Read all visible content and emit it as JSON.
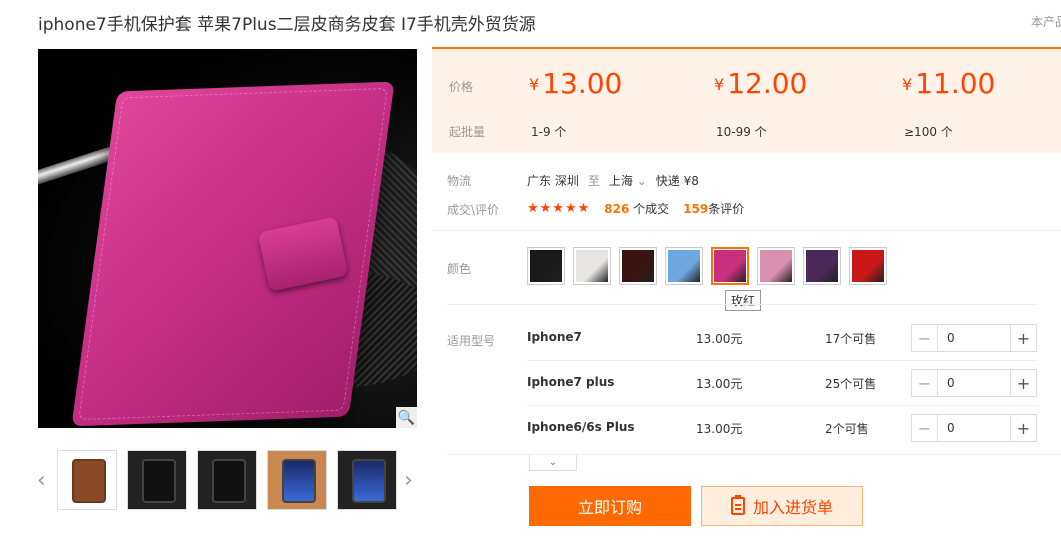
{
  "header": {
    "title": "iphone7手机保护套 苹果7Plus二层皮商务皮套 I7手机壳外贸货源",
    "right_text": "本产品"
  },
  "gallery": {
    "prev_label": "‹",
    "next_label": "›",
    "zoom_icon": "search-icon",
    "thumbnails": [
      "thumb-1",
      "thumb-2",
      "thumb-3",
      "thumb-4",
      "thumb-5"
    ],
    "bottom_cut_text": "... ... ..."
  },
  "pricing": {
    "price_label": "价格",
    "qty_label": "起批量",
    "currency": "¥",
    "tiers": [
      {
        "price": "13.00",
        "range": "1-9 个"
      },
      {
        "price": "12.00",
        "range": "10-99 个"
      },
      {
        "price": "11.00",
        "range": "≥100 个"
      }
    ]
  },
  "logistics": {
    "label": "物流",
    "from": "广东 深圳",
    "to_word": "至",
    "to": "上海",
    "shipping": "快递 ¥8"
  },
  "rating": {
    "label": "成交\\评价",
    "stars": "★★★★★",
    "deals_count": "826",
    "deals_text": "个成交",
    "reviews_count": "159",
    "reviews_text": "条评价"
  },
  "color": {
    "label": "颜色",
    "swatches": [
      "#1a1a1a",
      "#e8e6e2",
      "#3a1410",
      "#6fa8e0",
      "#c8307e",
      "#d88fb0",
      "#4a2a5a",
      "#c81818"
    ],
    "active_index": 4,
    "tooltip": "玫红"
  },
  "models": {
    "label": "适用型号",
    "rows": [
      {
        "name": "Iphone7",
        "price": "13.00元",
        "stock": "17个可售",
        "qty": "0"
      },
      {
        "name": "Iphone7 plus",
        "price": "13.00元",
        "stock": "25个可售",
        "qty": "0"
      },
      {
        "name": "Iphone6/6s Plus",
        "price": "13.00元",
        "stock": "2个可售",
        "qty": "0"
      }
    ],
    "minus": "−",
    "plus": "+",
    "expand_icon": "chevron-down-icon"
  },
  "actions": {
    "buy_now": "立即订购",
    "add_to_list": "加入进货单"
  }
}
